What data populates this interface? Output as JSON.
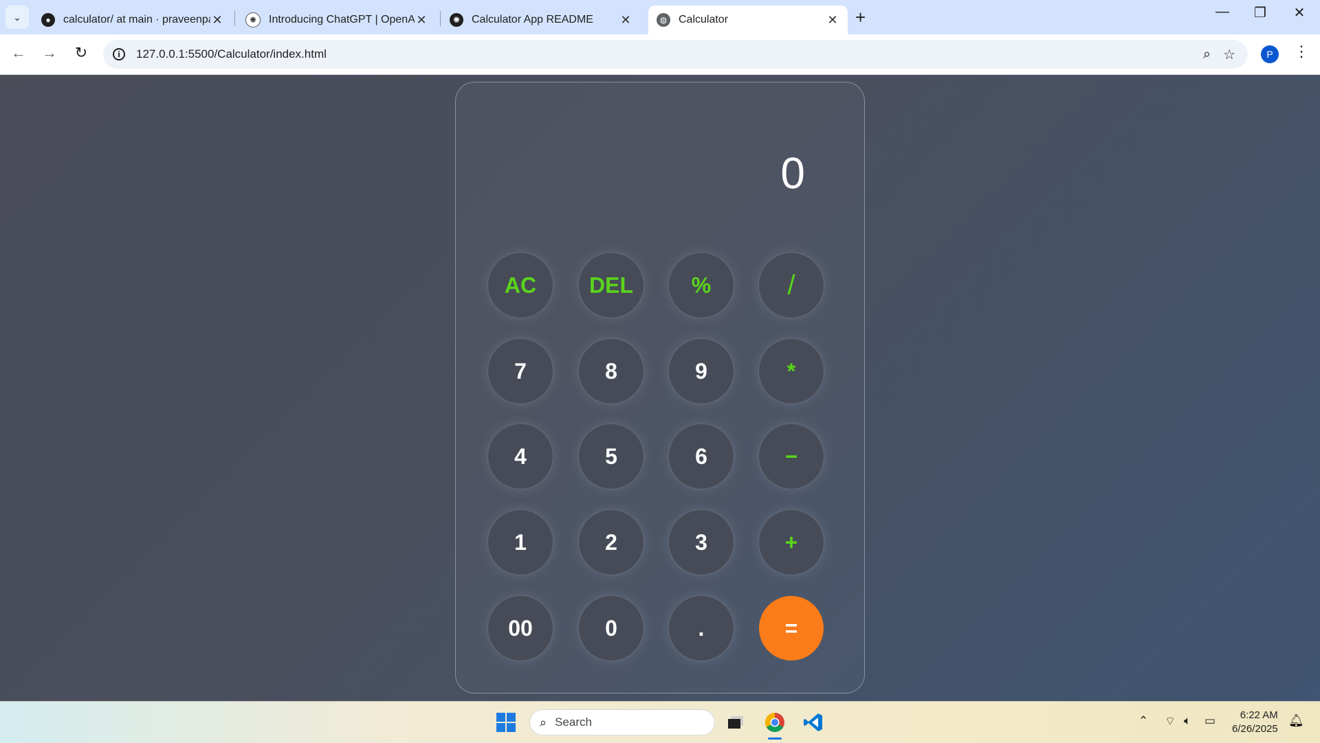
{
  "browser": {
    "tabs": [
      {
        "title": "calculator/ at main · praveenpal",
        "icon": "github-icon"
      },
      {
        "title": "Introducing ChatGPT | OpenAI",
        "icon": "openai-icon"
      },
      {
        "title": "Calculator App README",
        "icon": "openai-icon"
      },
      {
        "title": "Calculator",
        "icon": "globe-icon",
        "active": true
      }
    ],
    "url": "127.0.0.1:5500/Calculator/index.html",
    "profile_initial": "P"
  },
  "calculator": {
    "display": "0",
    "keys": {
      "ac": "AC",
      "del": "DEL",
      "percent": "%",
      "divide": "/",
      "seven": "7",
      "eight": "8",
      "nine": "9",
      "multiply": "*",
      "four": "4",
      "five": "5",
      "six": "6",
      "minus": "−",
      "one": "1",
      "two": "2",
      "three": "3",
      "plus": "+",
      "double_zero": "00",
      "zero": "0",
      "dot": ".",
      "equals": "="
    },
    "colors": {
      "operator": "#5ad41b",
      "equals": "#fb7c18"
    }
  },
  "taskbar": {
    "search_placeholder": "Search",
    "time": "6:22 AM",
    "date": "6/26/2025"
  }
}
